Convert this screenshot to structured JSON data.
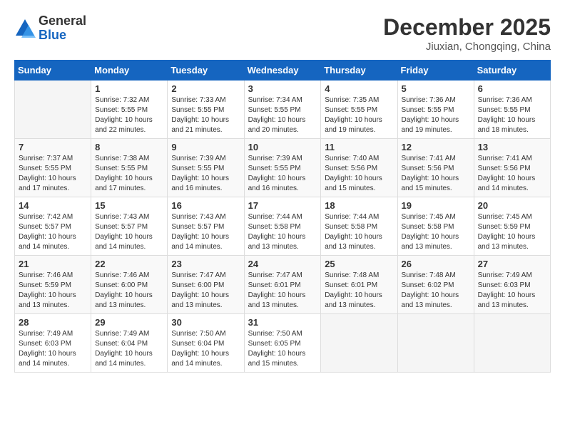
{
  "header": {
    "logo_general": "General",
    "logo_blue": "Blue",
    "month_title": "December 2025",
    "location": "Jiuxian, Chongqing, China"
  },
  "weekdays": [
    "Sunday",
    "Monday",
    "Tuesday",
    "Wednesday",
    "Thursday",
    "Friday",
    "Saturday"
  ],
  "weeks": [
    [
      {
        "day": "",
        "info": ""
      },
      {
        "day": "1",
        "info": "Sunrise: 7:32 AM\nSunset: 5:55 PM\nDaylight: 10 hours\nand 22 minutes."
      },
      {
        "day": "2",
        "info": "Sunrise: 7:33 AM\nSunset: 5:55 PM\nDaylight: 10 hours\nand 21 minutes."
      },
      {
        "day": "3",
        "info": "Sunrise: 7:34 AM\nSunset: 5:55 PM\nDaylight: 10 hours\nand 20 minutes."
      },
      {
        "day": "4",
        "info": "Sunrise: 7:35 AM\nSunset: 5:55 PM\nDaylight: 10 hours\nand 19 minutes."
      },
      {
        "day": "5",
        "info": "Sunrise: 7:36 AM\nSunset: 5:55 PM\nDaylight: 10 hours\nand 19 minutes."
      },
      {
        "day": "6",
        "info": "Sunrise: 7:36 AM\nSunset: 5:55 PM\nDaylight: 10 hours\nand 18 minutes."
      }
    ],
    [
      {
        "day": "7",
        "info": "Sunrise: 7:37 AM\nSunset: 5:55 PM\nDaylight: 10 hours\nand 17 minutes."
      },
      {
        "day": "8",
        "info": "Sunrise: 7:38 AM\nSunset: 5:55 PM\nDaylight: 10 hours\nand 17 minutes."
      },
      {
        "day": "9",
        "info": "Sunrise: 7:39 AM\nSunset: 5:55 PM\nDaylight: 10 hours\nand 16 minutes."
      },
      {
        "day": "10",
        "info": "Sunrise: 7:39 AM\nSunset: 5:55 PM\nDaylight: 10 hours\nand 16 minutes."
      },
      {
        "day": "11",
        "info": "Sunrise: 7:40 AM\nSunset: 5:56 PM\nDaylight: 10 hours\nand 15 minutes."
      },
      {
        "day": "12",
        "info": "Sunrise: 7:41 AM\nSunset: 5:56 PM\nDaylight: 10 hours\nand 15 minutes."
      },
      {
        "day": "13",
        "info": "Sunrise: 7:41 AM\nSunset: 5:56 PM\nDaylight: 10 hours\nand 14 minutes."
      }
    ],
    [
      {
        "day": "14",
        "info": "Sunrise: 7:42 AM\nSunset: 5:57 PM\nDaylight: 10 hours\nand 14 minutes."
      },
      {
        "day": "15",
        "info": "Sunrise: 7:43 AM\nSunset: 5:57 PM\nDaylight: 10 hours\nand 14 minutes."
      },
      {
        "day": "16",
        "info": "Sunrise: 7:43 AM\nSunset: 5:57 PM\nDaylight: 10 hours\nand 14 minutes."
      },
      {
        "day": "17",
        "info": "Sunrise: 7:44 AM\nSunset: 5:58 PM\nDaylight: 10 hours\nand 13 minutes."
      },
      {
        "day": "18",
        "info": "Sunrise: 7:44 AM\nSunset: 5:58 PM\nDaylight: 10 hours\nand 13 minutes."
      },
      {
        "day": "19",
        "info": "Sunrise: 7:45 AM\nSunset: 5:58 PM\nDaylight: 10 hours\nand 13 minutes."
      },
      {
        "day": "20",
        "info": "Sunrise: 7:45 AM\nSunset: 5:59 PM\nDaylight: 10 hours\nand 13 minutes."
      }
    ],
    [
      {
        "day": "21",
        "info": "Sunrise: 7:46 AM\nSunset: 5:59 PM\nDaylight: 10 hours\nand 13 minutes."
      },
      {
        "day": "22",
        "info": "Sunrise: 7:46 AM\nSunset: 6:00 PM\nDaylight: 10 hours\nand 13 minutes."
      },
      {
        "day": "23",
        "info": "Sunrise: 7:47 AM\nSunset: 6:00 PM\nDaylight: 10 hours\nand 13 minutes."
      },
      {
        "day": "24",
        "info": "Sunrise: 7:47 AM\nSunset: 6:01 PM\nDaylight: 10 hours\nand 13 minutes."
      },
      {
        "day": "25",
        "info": "Sunrise: 7:48 AM\nSunset: 6:01 PM\nDaylight: 10 hours\nand 13 minutes."
      },
      {
        "day": "26",
        "info": "Sunrise: 7:48 AM\nSunset: 6:02 PM\nDaylight: 10 hours\nand 13 minutes."
      },
      {
        "day": "27",
        "info": "Sunrise: 7:49 AM\nSunset: 6:03 PM\nDaylight: 10 hours\nand 13 minutes."
      }
    ],
    [
      {
        "day": "28",
        "info": "Sunrise: 7:49 AM\nSunset: 6:03 PM\nDaylight: 10 hours\nand 14 minutes."
      },
      {
        "day": "29",
        "info": "Sunrise: 7:49 AM\nSunset: 6:04 PM\nDaylight: 10 hours\nand 14 minutes."
      },
      {
        "day": "30",
        "info": "Sunrise: 7:50 AM\nSunset: 6:04 PM\nDaylight: 10 hours\nand 14 minutes."
      },
      {
        "day": "31",
        "info": "Sunrise: 7:50 AM\nSunset: 6:05 PM\nDaylight: 10 hours\nand 15 minutes."
      },
      {
        "day": "",
        "info": ""
      },
      {
        "day": "",
        "info": ""
      },
      {
        "day": "",
        "info": ""
      }
    ]
  ]
}
